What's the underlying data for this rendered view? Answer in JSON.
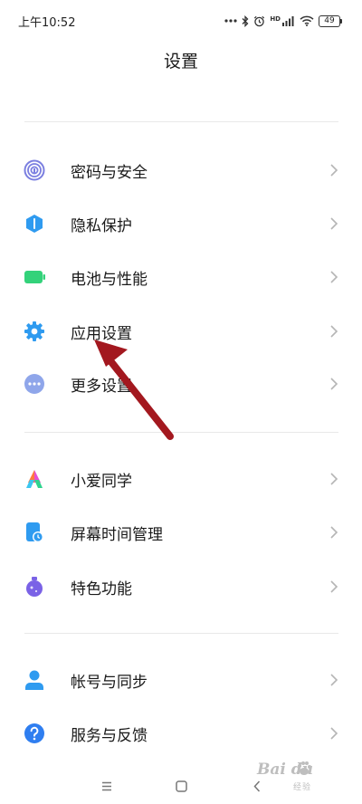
{
  "status_bar": {
    "time": "上午10:52",
    "hd_label": "HD",
    "battery_level": "49"
  },
  "header": {
    "title": "设置"
  },
  "sections": [
    {
      "items": [
        {
          "label": "密码与安全",
          "icon": "fingerprint-icon",
          "color": "#7b7fe0"
        },
        {
          "label": "隐私保护",
          "icon": "privacy-shield-icon",
          "color": "#2f9bf0"
        },
        {
          "label": "电池与性能",
          "icon": "battery-icon",
          "color": "#33d27a"
        },
        {
          "label": "应用设置",
          "icon": "gear-icon",
          "color": "#2f9bf0"
        },
        {
          "label": "更多设置",
          "icon": "more-icon",
          "color": "#8fa6ea"
        }
      ]
    },
    {
      "items": [
        {
          "label": "小爱同学",
          "icon": "xiaoai-icon",
          "color": "#ff7a3d"
        },
        {
          "label": "屏幕时间管理",
          "icon": "screen-time-icon",
          "color": "#2f9bf0"
        },
        {
          "label": "特色功能",
          "icon": "flask-icon",
          "color": "#7a62e6"
        }
      ]
    },
    {
      "items": [
        {
          "label": "帐号与同步",
          "icon": "account-icon",
          "color": "#2f9bf0"
        },
        {
          "label": "服务与反馈",
          "icon": "help-icon",
          "color": "#2f7ef0"
        }
      ]
    }
  ],
  "annotation": {
    "arrow_color": "#a3181f"
  },
  "watermark": {
    "brand": "Bai du",
    "sub": "经验"
  }
}
